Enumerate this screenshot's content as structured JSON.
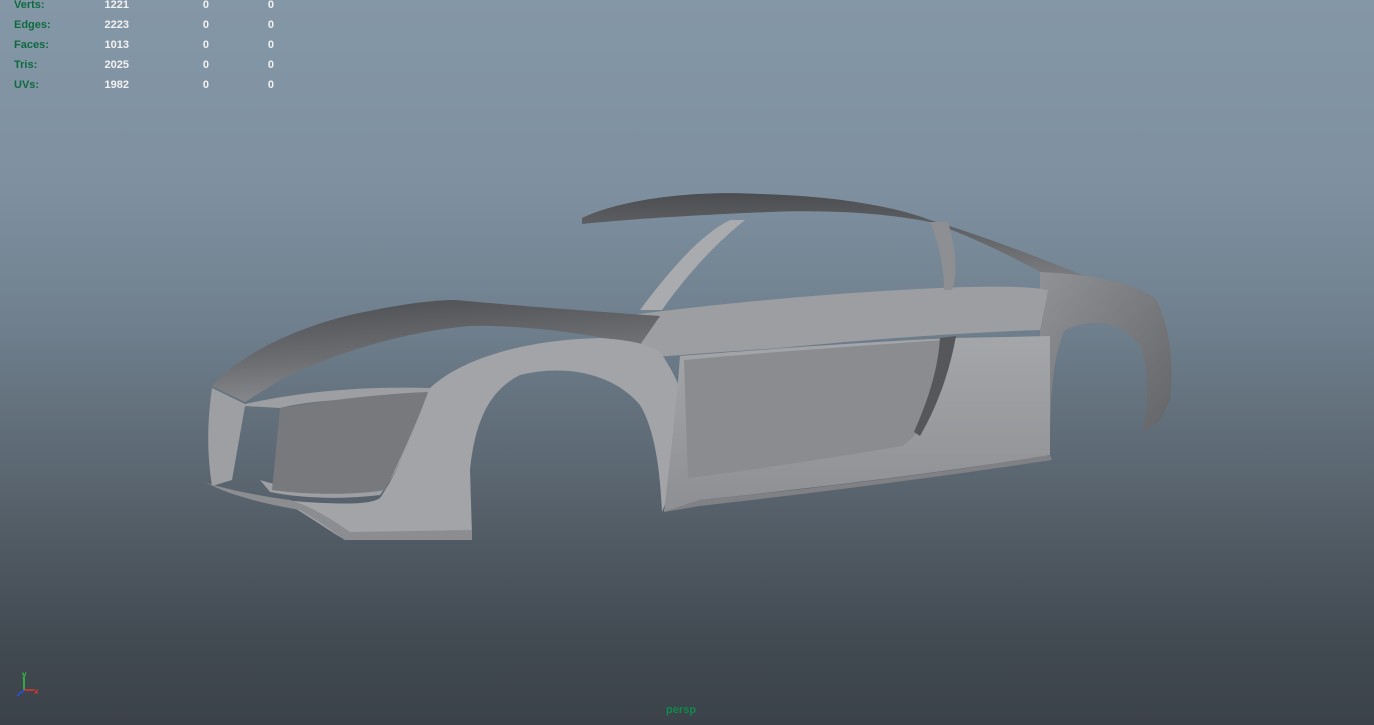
{
  "viewport": {
    "camera_label": "persp"
  },
  "hud": {
    "rows": [
      {
        "label": "Verts:",
        "total": "1221",
        "selected": "0",
        "extra": "0"
      },
      {
        "label": "Edges:",
        "total": "2223",
        "selected": "0",
        "extra": "0"
      },
      {
        "label": "Faces:",
        "total": "1013",
        "selected": "0",
        "extra": "0"
      },
      {
        "label": "Tris:",
        "total": "2025",
        "selected": "0",
        "extra": "0"
      },
      {
        "label": "UVs:",
        "total": "1982",
        "selected": "0",
        "extra": "0"
      }
    ]
  },
  "axis_gizmo": {
    "y_label": "y",
    "x_label": "x",
    "y_color": "#2ecc40",
    "x_color": "#e0342a",
    "z_color": "#2a4fe0"
  }
}
